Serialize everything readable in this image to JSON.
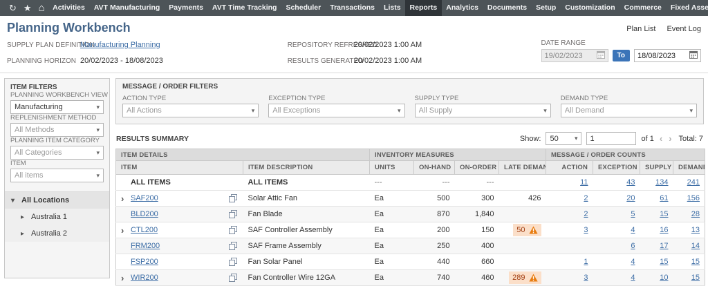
{
  "colors": {
    "nav_bg": "#4d5458",
    "nav_active_bg": "#2f3438",
    "title_blue": "#456589",
    "link_blue": "#3b6ca5",
    "to_badge_blue": "#3b74b8",
    "warning_bg": "#fbdfc9",
    "warning_icon": "#e87c10"
  },
  "icons": {
    "recent_records": "↻",
    "shortcuts_star": "★",
    "home": "⌂",
    "select_arrow": "▾",
    "tree_expanded": "▾",
    "tree_collapsed": "▸",
    "row_expand": "›",
    "pager_prev": "‹",
    "pager_next": "›"
  },
  "nav": {
    "items": [
      {
        "label": "Activities",
        "active": false
      },
      {
        "label": "AVT Manufacturing",
        "active": false
      },
      {
        "label": "Payments",
        "active": false
      },
      {
        "label": "AVT Time Tracking",
        "active": false
      },
      {
        "label": "Scheduler",
        "active": false
      },
      {
        "label": "Transactions",
        "active": false
      },
      {
        "label": "Lists",
        "active": false
      },
      {
        "label": "Reports",
        "active": true
      },
      {
        "label": "Analytics",
        "active": false
      },
      {
        "label": "Documents",
        "active": false
      },
      {
        "label": "Setup",
        "active": false
      },
      {
        "label": "Customization",
        "active": false
      },
      {
        "label": "Commerce",
        "active": false
      },
      {
        "label": "Fixed Assets",
        "active": false
      }
    ],
    "more_label": "..."
  },
  "header": {
    "title": "Planning Workbench",
    "links": [
      {
        "label": "Plan List"
      },
      {
        "label": "Event Log"
      }
    ]
  },
  "info": {
    "supply_plan_definition": {
      "label": "SUPPLY PLAN DEFINITION",
      "value": "Manufacturing Planning"
    },
    "planning_horizon": {
      "label": "PLANNING HORIZON",
      "value": "20/02/2023 - 18/08/2023"
    },
    "repository_refreshed": {
      "label": "REPOSITORY REFRESHED",
      "value": "20/02/2023 1:00 AM"
    },
    "results_generated": {
      "label": "RESULTS GENERATED",
      "value": "20/02/2023 1:00 AM"
    },
    "date_range": {
      "label": "DATE RANGE",
      "from": "19/02/2023",
      "to_label": "To",
      "to": "18/08/2023"
    }
  },
  "sidebar": {
    "title": "ITEM FILTERS",
    "filters": [
      {
        "label": "PLANNING WORKBENCH VIEW",
        "value": "Manufacturing",
        "muted": false
      },
      {
        "label": "REPLENISHMENT METHOD",
        "value": "All Methods",
        "muted": true
      },
      {
        "label": "PLANNING ITEM CATEGORY",
        "value": "All Categories",
        "muted": true
      },
      {
        "label": "ITEM",
        "value": "All items",
        "muted": true
      }
    ],
    "tree": {
      "root": "All Locations",
      "children": [
        {
          "label": "Australia 1"
        },
        {
          "label": "Australia 2"
        }
      ]
    }
  },
  "message_order_filters": {
    "title": "MESSAGE / ORDER FILTERS",
    "filters": [
      {
        "label": "ACTION TYPE",
        "value": "All Actions"
      },
      {
        "label": "EXCEPTION TYPE",
        "value": "All Exceptions"
      },
      {
        "label": "SUPPLY TYPE",
        "value": "All Supply"
      },
      {
        "label": "DEMAND TYPE",
        "value": "All Demand"
      }
    ]
  },
  "results": {
    "title": "RESULTS SUMMARY",
    "pager": {
      "show_label": "Show:",
      "page_size": "50",
      "page_value": "1",
      "of_label": "of 1",
      "total_label": "Total: 7"
    },
    "table": {
      "group_headers": [
        {
          "label": "ITEM DETAILS"
        },
        {
          "label": "INVENTORY MEASURES"
        },
        {
          "label": "MESSAGE / ORDER COUNTS"
        }
      ],
      "columns": [
        {
          "label": "ITEM"
        },
        {
          "label": "ITEM DESCRIPTION"
        },
        {
          "label": "UNITS"
        },
        {
          "label": "ON-HAND"
        },
        {
          "label": "ON-ORDER"
        },
        {
          "label": "LATE DEMAND"
        },
        {
          "label": "ACTION"
        },
        {
          "label": "EXCEPTION"
        },
        {
          "label": "SUPPLY"
        },
        {
          "label": "DEMAND"
        }
      ],
      "rows": [
        {
          "item": "ALL ITEMS",
          "description": "ALL ITEMS",
          "units": "---",
          "on_hand": "---",
          "on_order": "---",
          "late_demand": "",
          "late_warning": false,
          "expandable": false,
          "action": "11",
          "exception": "43",
          "supply": "134",
          "demand": "241"
        },
        {
          "item": "SAF200",
          "description": "Solar Attic Fan",
          "units": "Ea",
          "on_hand": "500",
          "on_order": "300",
          "late_demand": "426",
          "late_warning": false,
          "expandable": true,
          "action": "2",
          "exception": "20",
          "supply": "61",
          "demand": "156"
        },
        {
          "item": "BLD200",
          "description": "Fan Blade",
          "units": "Ea",
          "on_hand": "870",
          "on_order": "1,840",
          "late_demand": "",
          "late_warning": false,
          "expandable": false,
          "action": "2",
          "exception": "5",
          "supply": "15",
          "demand": "28"
        },
        {
          "item": "CTL200",
          "description": "SAF Controller Assembly",
          "units": "Ea",
          "on_hand": "200",
          "on_order": "150",
          "late_demand": "50",
          "late_warning": true,
          "expandable": true,
          "action": "3",
          "exception": "4",
          "supply": "16",
          "demand": "13"
        },
        {
          "item": "FRM200",
          "description": "SAF Frame Assembly",
          "units": "Ea",
          "on_hand": "250",
          "on_order": "400",
          "late_demand": "",
          "late_warning": false,
          "expandable": false,
          "action": "",
          "exception": "6",
          "supply": "17",
          "demand": "14"
        },
        {
          "item": "FSP200",
          "description": "Fan Solar Panel",
          "units": "Ea",
          "on_hand": "440",
          "on_order": "660",
          "late_demand": "",
          "late_warning": false,
          "expandable": false,
          "action": "1",
          "exception": "4",
          "supply": "15",
          "demand": "15"
        },
        {
          "item": "WIR200",
          "description": "Fan Controller Wire 12GA",
          "units": "Ea",
          "on_hand": "740",
          "on_order": "460",
          "late_demand": "289",
          "late_warning": true,
          "expandable": true,
          "action": "3",
          "exception": "4",
          "supply": "10",
          "demand": "15"
        }
      ]
    }
  }
}
